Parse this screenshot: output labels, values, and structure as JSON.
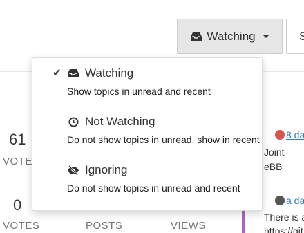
{
  "header": {
    "watch_button_label": "Watching",
    "sort_button_label": "S"
  },
  "dropdown": {
    "options": [
      {
        "label": "Watching",
        "description": "Show topics in unread and recent",
        "icon": "inbox-icon",
        "selected": true
      },
      {
        "label": "Not Watching",
        "description": "Do not show topics in unread, show in recent",
        "icon": "clock-icon",
        "selected": false
      },
      {
        "label": "Ignoring",
        "description": "Do not show topics in unread and recent",
        "icon": "eye-slash-icon",
        "selected": false
      }
    ]
  },
  "topics": [
    {
      "votes": "61",
      "votes_label": "VOTES"
    },
    {
      "votes": "0",
      "votes_label": "VOTES",
      "posts_label": "POSTS",
      "views_label": "VIEWS"
    }
  ],
  "teasers": [
    {
      "time": "8 da",
      "line1": "Joint",
      "line2": "eBB"
    },
    {
      "time": "a da",
      "line1": "There is a",
      "line2": "https://git"
    }
  ],
  "colors": {
    "accent_purple": "#b060c8",
    "link": "#337ab7",
    "avatar_red": "#d9534f"
  }
}
